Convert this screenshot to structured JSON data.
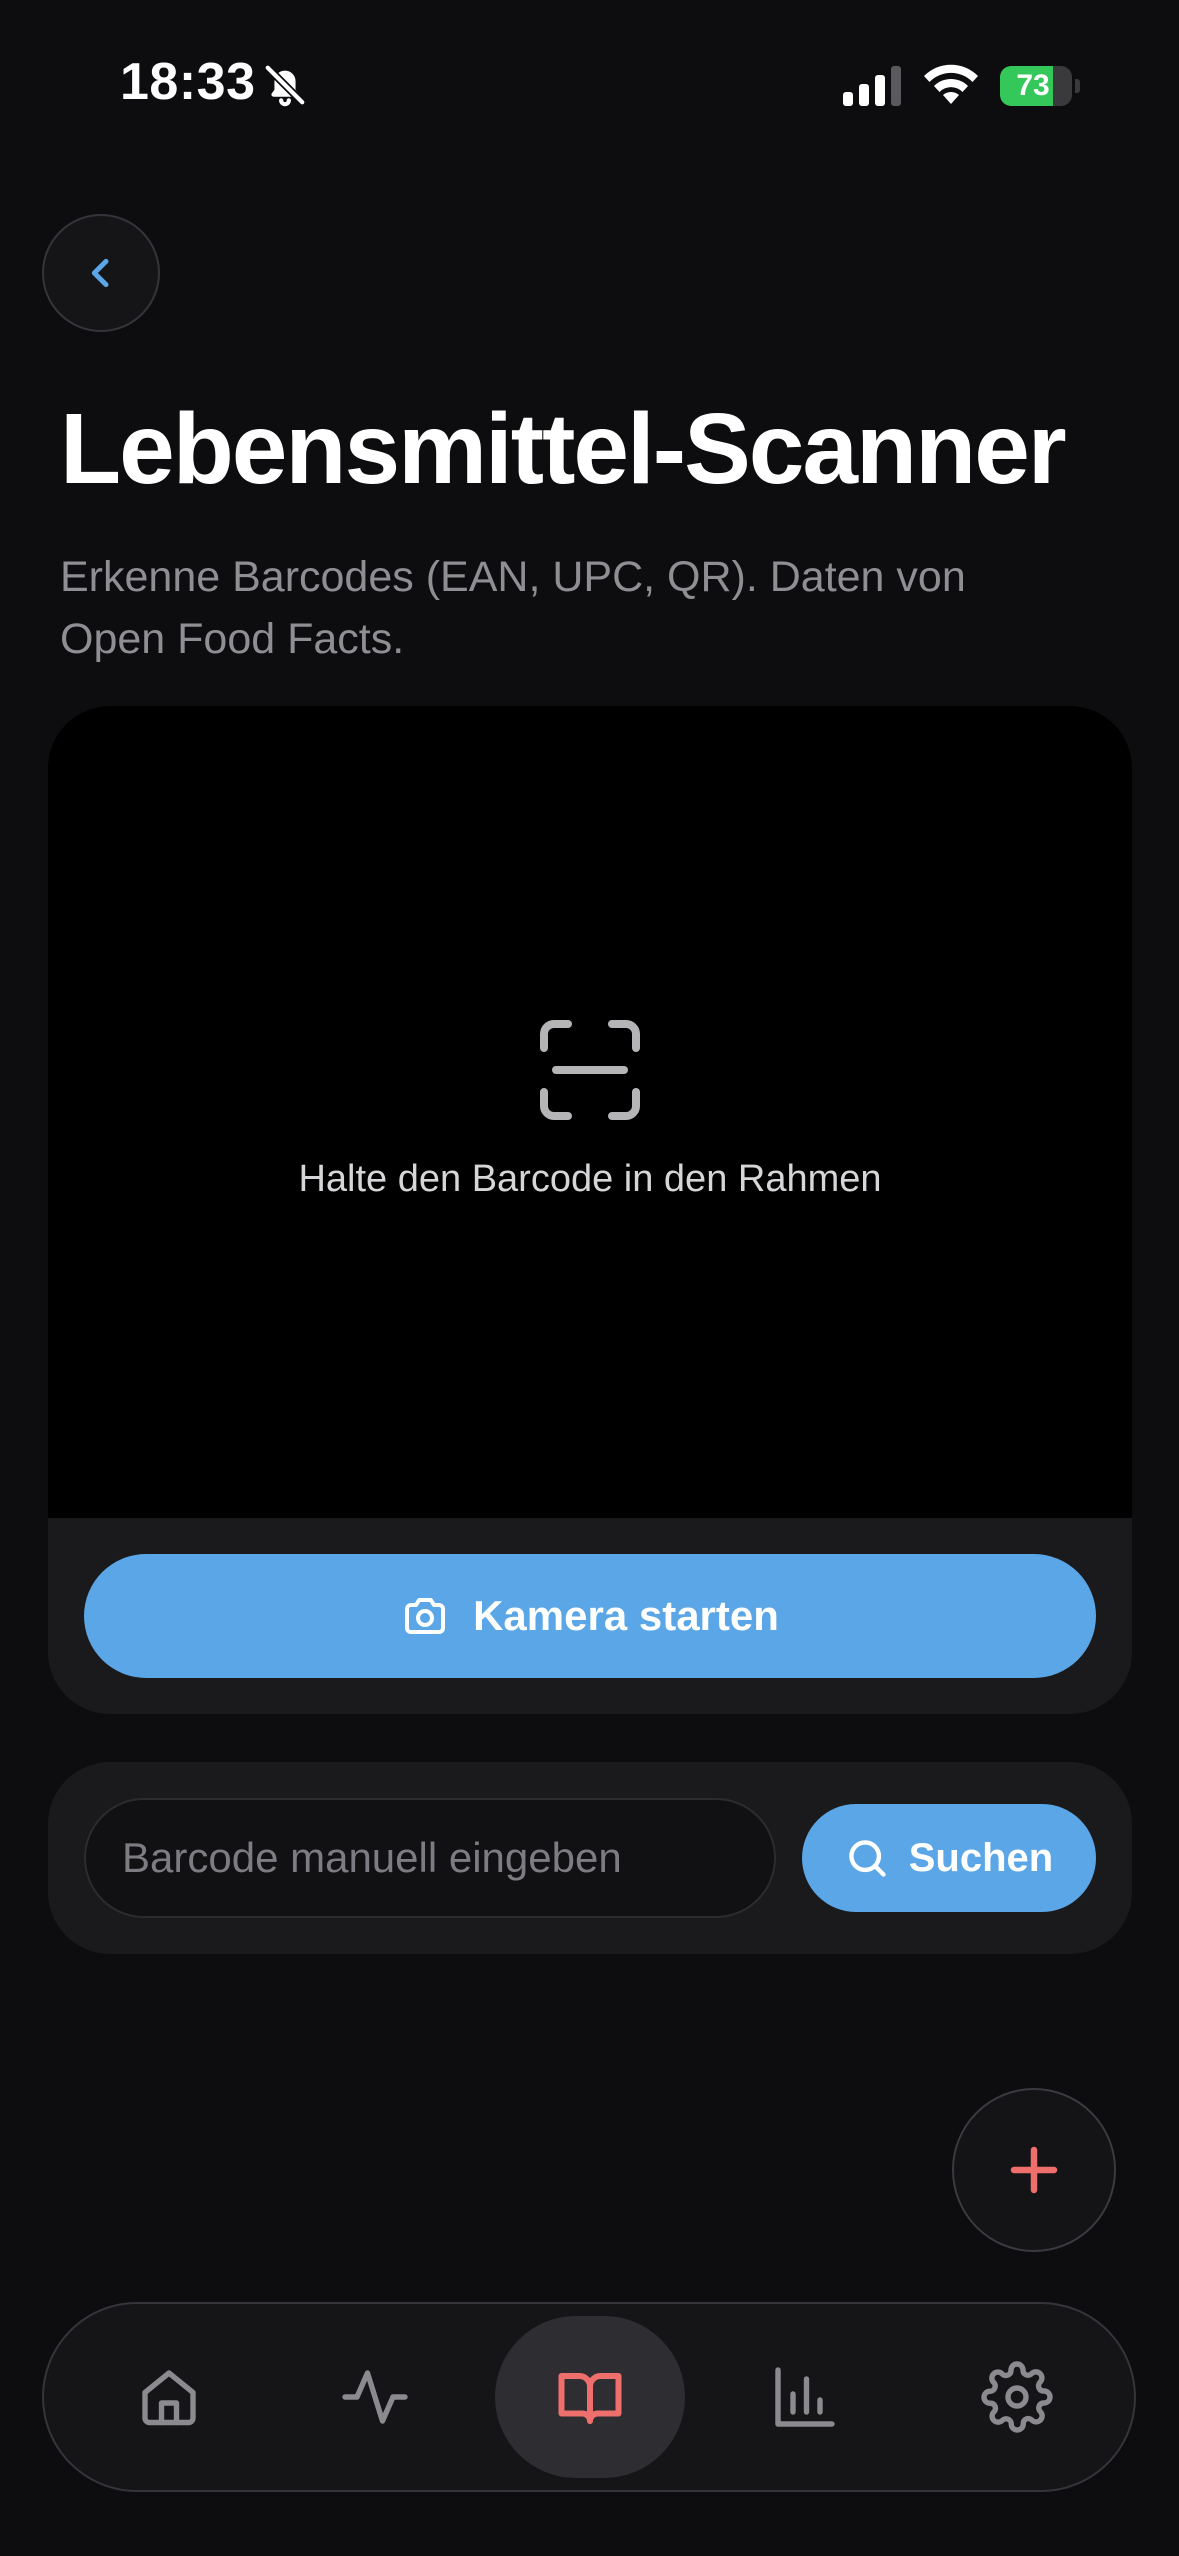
{
  "status_bar": {
    "time": "18:33",
    "battery_level": "73",
    "battery_fraction": 0.73,
    "icons": [
      "bell-muted-icon",
      "cellular-signal-icon",
      "wifi-icon",
      "battery-charging-icon"
    ]
  },
  "header": {
    "back_icon": "chevron-left-icon",
    "title": "Lebensmittel-Scanner",
    "subtitle": "Erkenne Barcodes (EAN, UPC, QR). Daten von Open Food Facts."
  },
  "scanner": {
    "frame_icon": "scan-frame-icon",
    "hint": "Halte den Barcode in den Rahmen",
    "camera_icon": "camera-icon",
    "camera_button_label": "Kamera starten"
  },
  "manual_entry": {
    "placeholder": "Barcode manuell eingeben",
    "value": "",
    "search_icon": "search-icon",
    "search_button_label": "Suchen"
  },
  "fab": {
    "icon": "plus-icon"
  },
  "tab_bar": {
    "tabs": [
      {
        "icon": "home-icon",
        "active": false
      },
      {
        "icon": "activity-icon",
        "active": false
      },
      {
        "icon": "book-open-icon",
        "active": true
      },
      {
        "icon": "bar-chart-icon",
        "active": false
      },
      {
        "icon": "gear-icon",
        "active": false
      }
    ]
  },
  "colors": {
    "background": "#0d0d10",
    "card": "#1a1a1d",
    "accent_blue": "#5aa6e6",
    "accent_red": "#ef6f6c",
    "text_primary": "#ffffff",
    "text_secondary": "#8e8e93",
    "battery_green": "#34c759"
  }
}
